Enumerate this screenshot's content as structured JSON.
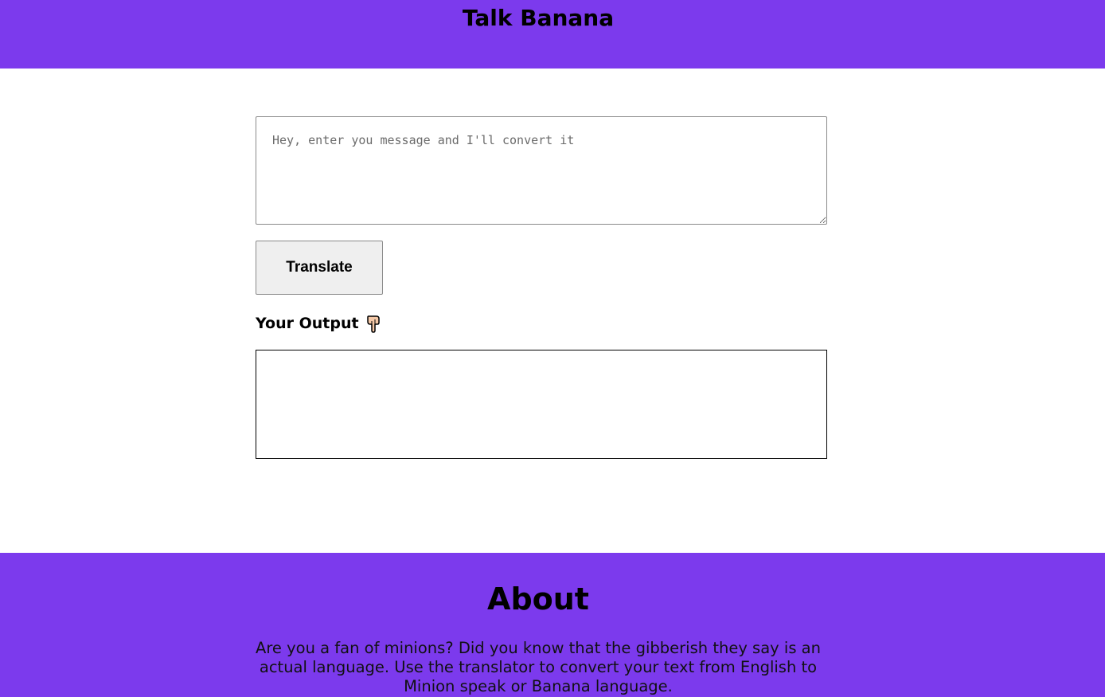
{
  "header": {
    "title": "Talk Banana"
  },
  "translator": {
    "input_placeholder": "Hey, enter you message and I'll convert it",
    "input_value": "",
    "translate_label": "Translate",
    "output_label": "Your Output",
    "output_icon": "backhand-index-pointing-down-icon",
    "output_value": ""
  },
  "about": {
    "title": "About",
    "text": "Are you a fan of minions? Did you know that the gibberish they say is an actual language. Use the translator to convert your text from English to Minion speak or Banana language."
  },
  "colors": {
    "brand_purple": "#7c3aed",
    "background": "#ffffff",
    "button_bg": "#efefef"
  }
}
